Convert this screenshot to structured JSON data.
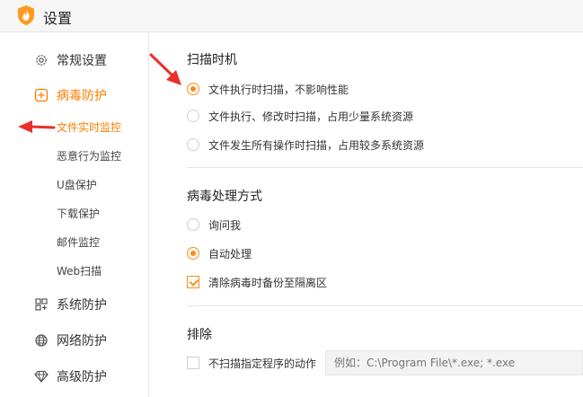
{
  "window": {
    "title": "设置"
  },
  "sidebar": {
    "items": [
      {
        "label": "常规设置",
        "icon": "gear-icon"
      },
      {
        "label": "病毒防护",
        "icon": "plus-square-icon",
        "active": true,
        "subitems": [
          {
            "label": "文件实时监控",
            "active": true
          },
          {
            "label": "恶意行为监控"
          },
          {
            "label": "U盘保护"
          },
          {
            "label": "下载保护"
          },
          {
            "label": "邮件监控"
          },
          {
            "label": "Web扫描"
          }
        ]
      },
      {
        "label": "系统防护",
        "icon": "grid-icon"
      },
      {
        "label": "网络防护",
        "icon": "globe-icon"
      },
      {
        "label": "高级防护",
        "icon": "diamond-icon"
      }
    ]
  },
  "scan_timing": {
    "title": "扫描时机",
    "options": [
      {
        "label": "文件执行时扫描，不影响性能",
        "checked": true
      },
      {
        "label": "文件执行、修改时扫描，占用少量系统资源",
        "checked": false
      },
      {
        "label": "文件发生所有操作时扫描，占用较多系统资源",
        "checked": false
      }
    ]
  },
  "virus_handling": {
    "title": "病毒处理方式",
    "options": [
      {
        "label": "询问我",
        "checked": false
      },
      {
        "label": "自动处理",
        "checked": true
      }
    ],
    "backup": {
      "label": "清除病毒时备份至隔离区",
      "checked": true
    }
  },
  "exclude": {
    "title": "排除",
    "checkbox": {
      "label": "不扫描指定程序的动作",
      "checked": false
    },
    "input_placeholder": "例如：C:\\Program File\\*.exe; *.exe"
  },
  "colors": {
    "accent": "#ff7d00",
    "arrow": "#e8302a"
  }
}
